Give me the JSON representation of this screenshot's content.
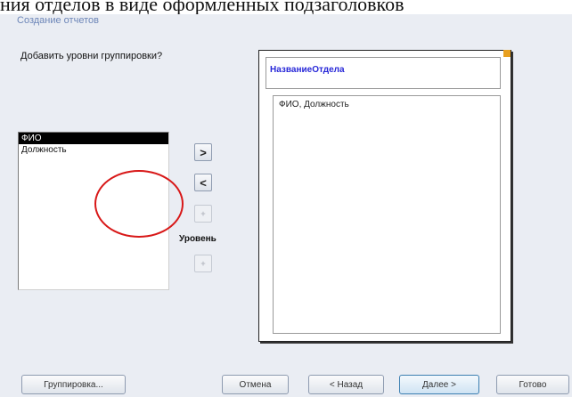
{
  "document": {
    "text": "ния отделов в виде оформленных подзаголовков"
  },
  "dialog": {
    "title": "Создание отчетов"
  },
  "question": "Добавить уровни группировки?",
  "fields": [
    {
      "label": "ФИО",
      "selected": true
    },
    {
      "label": "Должность",
      "selected": false
    }
  ],
  "controls": {
    "add": ">",
    "remove": "<",
    "priority_up": "+",
    "priority_label": "Уровень",
    "priority_down": "+"
  },
  "preview": {
    "group_header": "НазваниеОтдела",
    "detail_fields": "ФИО, Должность"
  },
  "buttons": {
    "grouping": "Группировка...",
    "cancel": "Отмена",
    "back": "< Назад",
    "next": "Далее >",
    "finish": "Готово"
  },
  "colors": {
    "group_header_text": "#2828d8",
    "annotation_circle": "#d81818"
  }
}
